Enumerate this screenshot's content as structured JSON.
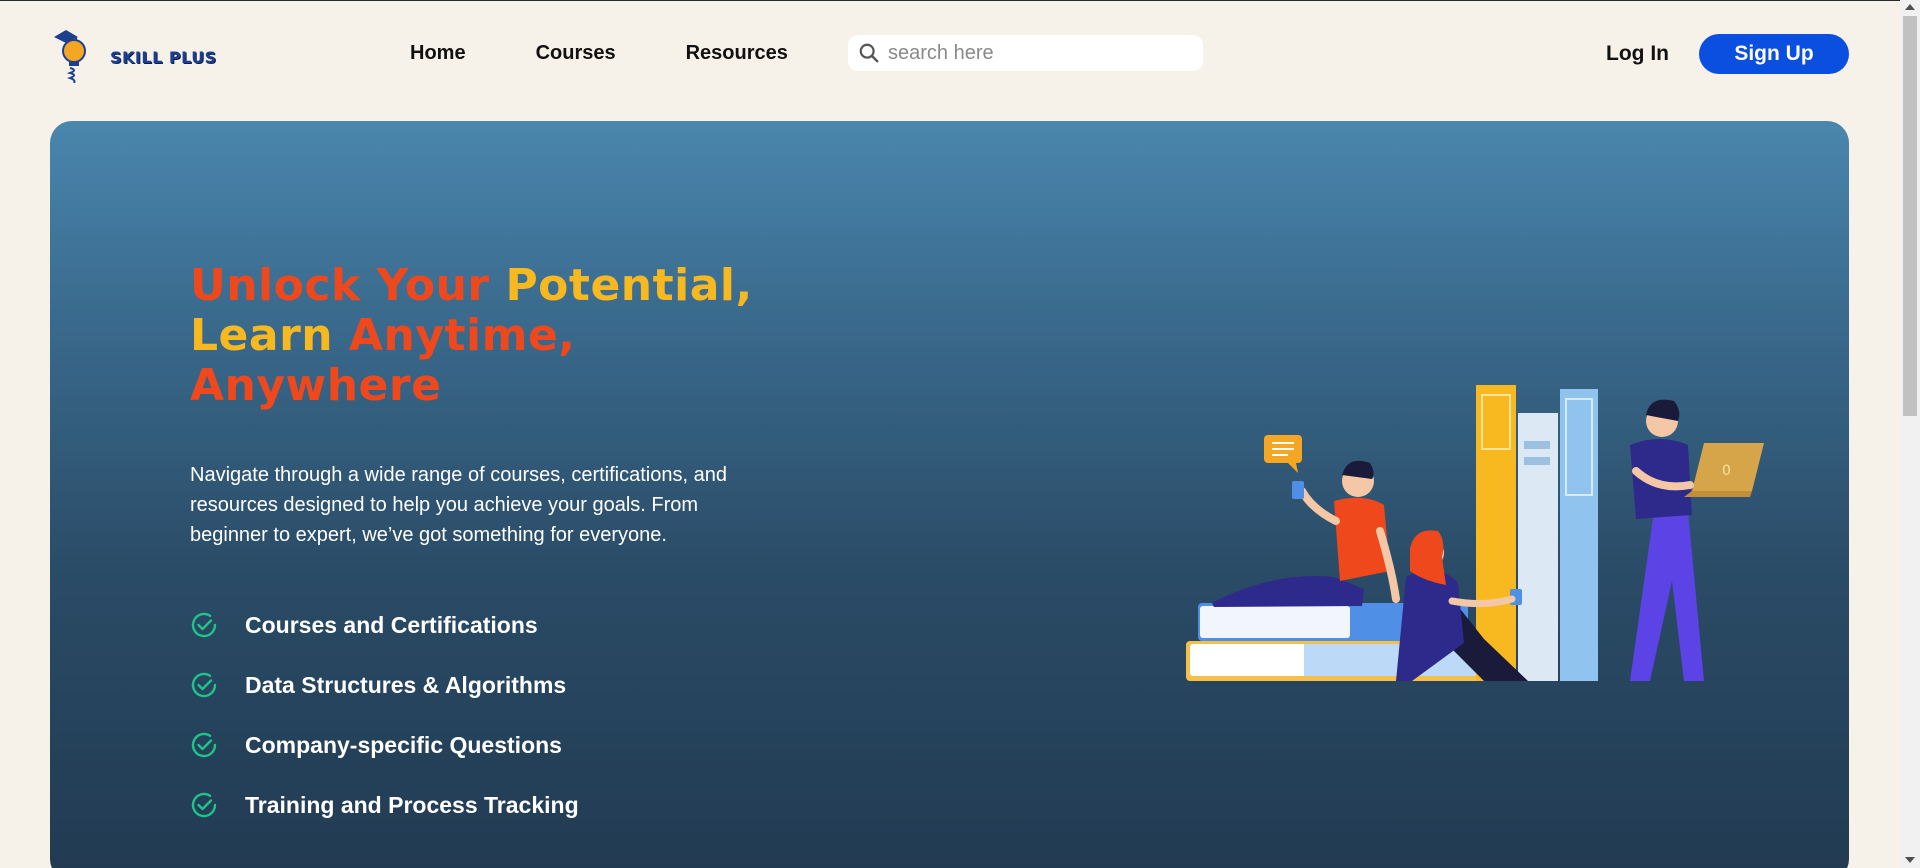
{
  "brand": {
    "name": "SKILL PLUS",
    "colors": {
      "primary": "#0b4fe0",
      "accent_red": "#f0481d",
      "accent_yellow": "#f8b81f",
      "check": "#1fc48a"
    }
  },
  "nav": {
    "links": [
      "Home",
      "Courses",
      "Resources"
    ],
    "search_placeholder": "search here",
    "login_label": "Log In",
    "signup_label": "Sign Up"
  },
  "hero": {
    "headline": {
      "part1": "Unlock Your",
      "part2": "Potential,",
      "part3": "Learn",
      "part4": "Anytime,",
      "part5": "Anywhere"
    },
    "description": "Navigate through a wide range of courses, certifications, and resources designed to help you achieve your goals. From beginner to expert, we’ve got something for everyone.",
    "features": [
      "Courses and Certifications",
      "Data Structures & Algorithms",
      "Company-specific Questions",
      "Training and Process Tracking"
    ],
    "laptop_text": "0"
  },
  "icons": {
    "logo": "lightbulb-graduation-icon",
    "search": "search-icon",
    "check": "check-circle-icon",
    "chat": "chat-bubble-icon"
  }
}
